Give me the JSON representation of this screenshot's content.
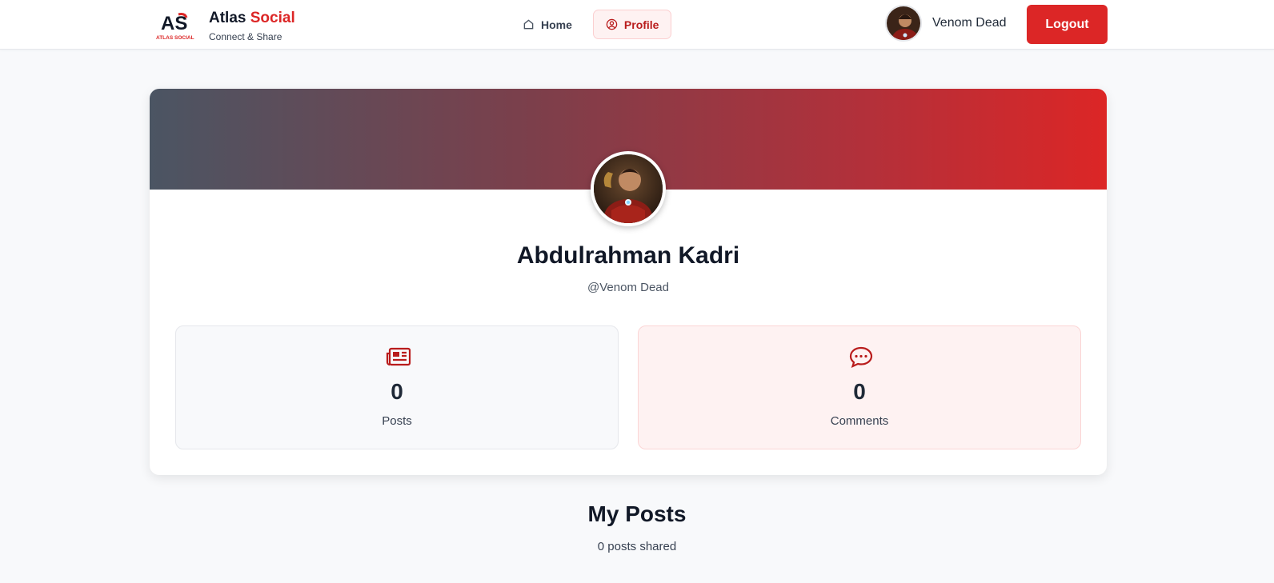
{
  "brand": {
    "logo_text": "AS",
    "logo_caption": "ATLAS SOCIAL",
    "title_main": "Atlas",
    "title_accent": "Social",
    "subtitle": "Connect & Share"
  },
  "nav": {
    "items": [
      {
        "label": "Home",
        "icon": "home-icon",
        "active": false
      },
      {
        "label": "Profile",
        "icon": "user-circle-icon",
        "active": true
      }
    ]
  },
  "user": {
    "display_name": "Venom Dead",
    "avatar": "avatar-icon"
  },
  "header": {
    "logout_label": "Logout"
  },
  "profile": {
    "full_name": "Abdulrahman Kadri",
    "handle": "@Venom Dead",
    "stats": [
      {
        "value": "0",
        "label": "Posts",
        "icon": "newspaper-icon"
      },
      {
        "value": "0",
        "label": "Comments",
        "icon": "chat-icon"
      }
    ]
  },
  "posts_section": {
    "title": "My Posts",
    "subtitle": "0 posts shared"
  },
  "colors": {
    "accent": "#dc2626",
    "cover_start": "#4b5563",
    "cover_end": "#dc2626"
  }
}
